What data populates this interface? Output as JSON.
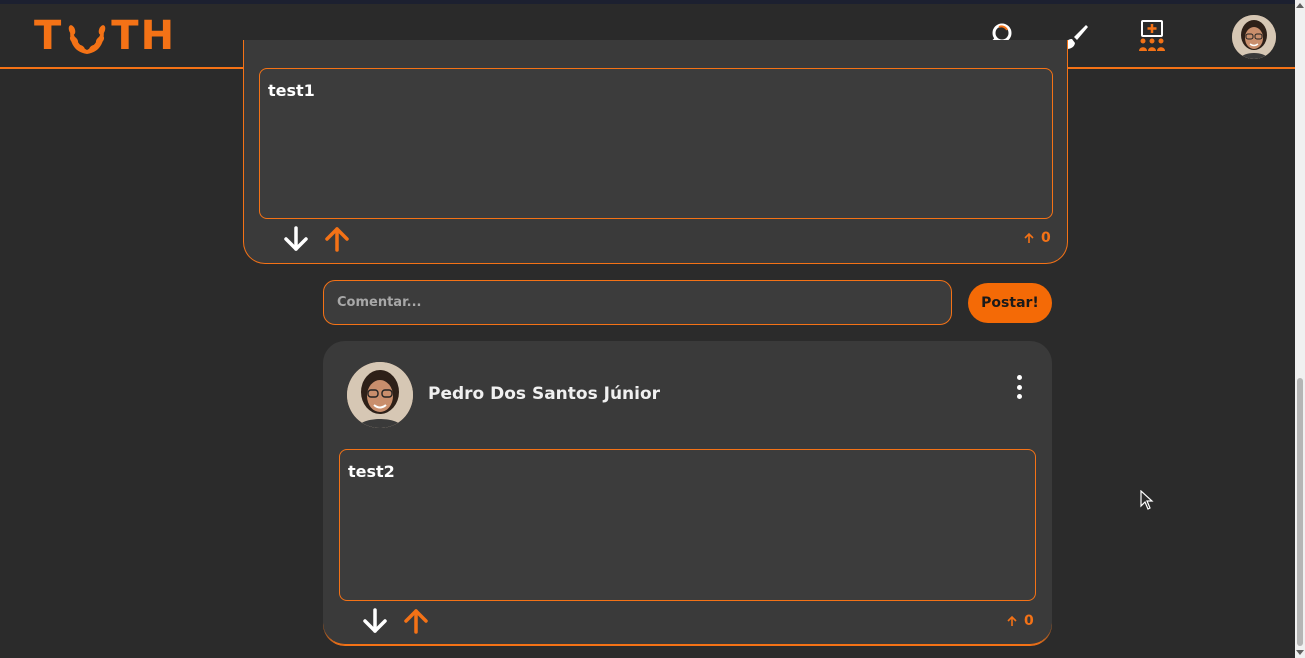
{
  "app": {
    "logo_letters": [
      "T",
      "T",
      "H"
    ],
    "accent_color": "#f47216"
  },
  "nav": {
    "icons": [
      "search-icon",
      "brush-icon",
      "community-add-icon"
    ],
    "profile": "profile-avatar"
  },
  "post": {
    "content": "test1",
    "vote_down_icon": "arrow-down-icon",
    "vote_up_icon": "arrow-up-icon",
    "score_icon": "arrow-up-small-icon",
    "score": "0"
  },
  "comment_form": {
    "placeholder": "Comentar...",
    "submit_label": "Postar!"
  },
  "comment": {
    "author": "Pedro Dos Santos Júnior",
    "menu_icon": "more-vertical-icon",
    "content": "test2",
    "score": "0"
  }
}
